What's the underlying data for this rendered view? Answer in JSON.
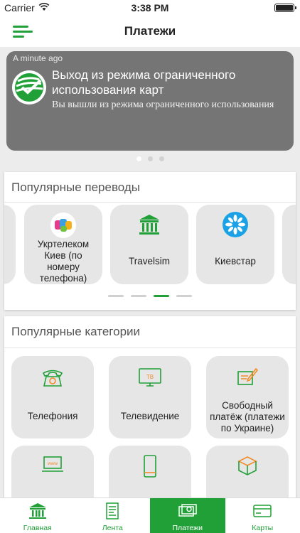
{
  "status_bar": {
    "carrier": "Carrier",
    "time": "3:38 PM"
  },
  "nav": {
    "title": "Платежи"
  },
  "notification": {
    "time": "A minute ago",
    "title": "Выход из режима ограниченного использования карт",
    "body": "Вы вышли из режима ограниченного использования"
  },
  "popular_transfers": {
    "title": "Популярные переводы",
    "items": [
      {
        "label": "Укртелеком Киев (по номеру телефона)",
        "icon": "ukrtelecom-logo-icon"
      },
      {
        "label": "Travelsim",
        "icon": "bank-building-icon"
      },
      {
        "label": "Киевстар",
        "icon": "kyivstar-logo-icon"
      }
    ]
  },
  "popular_categories": {
    "title": "Популярные категории",
    "items": [
      {
        "label": "Телефония",
        "icon": "telephone-icon"
      },
      {
        "label": "Телевидение",
        "icon": "tv-icon"
      },
      {
        "label": "Свободный платёж (платежи по Украине)",
        "icon": "free-payment-icon"
      },
      {
        "label": "",
        "icon": "internet-laptop-icon"
      },
      {
        "label": "",
        "icon": "mobile-phone-icon"
      },
      {
        "label": "",
        "icon": "package-box-icon"
      }
    ]
  },
  "tab_bar": {
    "tabs": [
      {
        "label": "Главная",
        "icon": "bank-building-icon"
      },
      {
        "label": "Лента",
        "icon": "newspaper-icon"
      },
      {
        "label": "Платежи",
        "icon": "payments-icon",
        "active": true
      },
      {
        "label": "Карты",
        "icon": "card-icon"
      }
    ]
  },
  "colors": {
    "accent": "#21a038",
    "notification_bg": "#757575",
    "tile_bg": "#e6e6e6"
  }
}
